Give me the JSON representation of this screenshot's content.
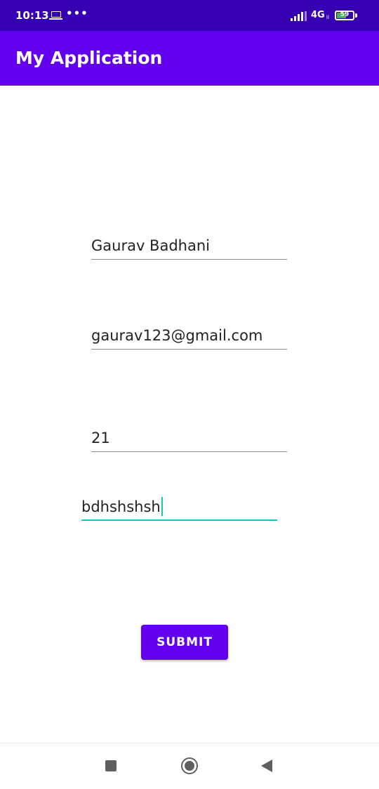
{
  "status_bar": {
    "time": "10:13",
    "dots": "•••",
    "network": "4G",
    "network_small": "ll",
    "battery_level": 59,
    "battery_text": "59",
    "icons": [
      "laptop-icon",
      "signal-icon",
      "battery-icon"
    ]
  },
  "app_bar": {
    "title": "My Application"
  },
  "form": {
    "name_value": "Gaurav Badhani",
    "email_value": "gaurav123@gmail.com",
    "age_value": "21",
    "other_value": "bdhshshsh",
    "submit_label": "SUBMIT"
  },
  "nav_bar": {
    "icons": [
      "recent-apps-icon",
      "home-icon",
      "back-icon"
    ]
  },
  "colors": {
    "status_bar": "#3700b3",
    "app_bar": "#6200ee",
    "accent": "#10c9c0",
    "button": "#6200ee"
  }
}
